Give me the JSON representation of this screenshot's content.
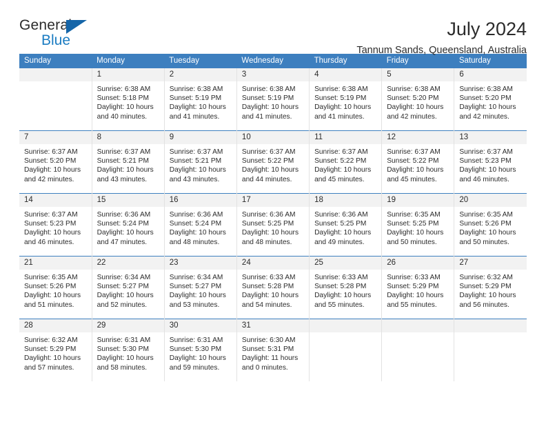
{
  "brand": {
    "name_part1": "General",
    "name_part2": "Blue",
    "logo_icon": "triangle-flag-icon"
  },
  "header": {
    "title": "July 2024",
    "subtitle": "Tannum Sands, Queensland, Australia"
  },
  "colors": {
    "header_blue": "#3d7fbf",
    "brand_blue": "#1b7cc2",
    "logo_blue": "#1565a8",
    "daynum_band": "#f2f2f2",
    "cell_divider": "#e2e2e2",
    "text": "#2b2b2b"
  },
  "weekday_headers": [
    "Sunday",
    "Monday",
    "Tuesday",
    "Wednesday",
    "Thursday",
    "Friday",
    "Saturday"
  ],
  "weeks": [
    [
      {
        "day": "",
        "sunrise": "",
        "sunset": "",
        "daylight_line1": "",
        "daylight_line2": ""
      },
      {
        "day": "1",
        "sunrise": "Sunrise: 6:38 AM",
        "sunset": "Sunset: 5:18 PM",
        "daylight_line1": "Daylight: 10 hours",
        "daylight_line2": "and 40 minutes."
      },
      {
        "day": "2",
        "sunrise": "Sunrise: 6:38 AM",
        "sunset": "Sunset: 5:19 PM",
        "daylight_line1": "Daylight: 10 hours",
        "daylight_line2": "and 41 minutes."
      },
      {
        "day": "3",
        "sunrise": "Sunrise: 6:38 AM",
        "sunset": "Sunset: 5:19 PM",
        "daylight_line1": "Daylight: 10 hours",
        "daylight_line2": "and 41 minutes."
      },
      {
        "day": "4",
        "sunrise": "Sunrise: 6:38 AM",
        "sunset": "Sunset: 5:19 PM",
        "daylight_line1": "Daylight: 10 hours",
        "daylight_line2": "and 41 minutes."
      },
      {
        "day": "5",
        "sunrise": "Sunrise: 6:38 AM",
        "sunset": "Sunset: 5:20 PM",
        "daylight_line1": "Daylight: 10 hours",
        "daylight_line2": "and 42 minutes."
      },
      {
        "day": "6",
        "sunrise": "Sunrise: 6:38 AM",
        "sunset": "Sunset: 5:20 PM",
        "daylight_line1": "Daylight: 10 hours",
        "daylight_line2": "and 42 minutes."
      }
    ],
    [
      {
        "day": "7",
        "sunrise": "Sunrise: 6:37 AM",
        "sunset": "Sunset: 5:20 PM",
        "daylight_line1": "Daylight: 10 hours",
        "daylight_line2": "and 42 minutes."
      },
      {
        "day": "8",
        "sunrise": "Sunrise: 6:37 AM",
        "sunset": "Sunset: 5:21 PM",
        "daylight_line1": "Daylight: 10 hours",
        "daylight_line2": "and 43 minutes."
      },
      {
        "day": "9",
        "sunrise": "Sunrise: 6:37 AM",
        "sunset": "Sunset: 5:21 PM",
        "daylight_line1": "Daylight: 10 hours",
        "daylight_line2": "and 43 minutes."
      },
      {
        "day": "10",
        "sunrise": "Sunrise: 6:37 AM",
        "sunset": "Sunset: 5:22 PM",
        "daylight_line1": "Daylight: 10 hours",
        "daylight_line2": "and 44 minutes."
      },
      {
        "day": "11",
        "sunrise": "Sunrise: 6:37 AM",
        "sunset": "Sunset: 5:22 PM",
        "daylight_line1": "Daylight: 10 hours",
        "daylight_line2": "and 45 minutes."
      },
      {
        "day": "12",
        "sunrise": "Sunrise: 6:37 AM",
        "sunset": "Sunset: 5:22 PM",
        "daylight_line1": "Daylight: 10 hours",
        "daylight_line2": "and 45 minutes."
      },
      {
        "day": "13",
        "sunrise": "Sunrise: 6:37 AM",
        "sunset": "Sunset: 5:23 PM",
        "daylight_line1": "Daylight: 10 hours",
        "daylight_line2": "and 46 minutes."
      }
    ],
    [
      {
        "day": "14",
        "sunrise": "Sunrise: 6:37 AM",
        "sunset": "Sunset: 5:23 PM",
        "daylight_line1": "Daylight: 10 hours",
        "daylight_line2": "and 46 minutes."
      },
      {
        "day": "15",
        "sunrise": "Sunrise: 6:36 AM",
        "sunset": "Sunset: 5:24 PM",
        "daylight_line1": "Daylight: 10 hours",
        "daylight_line2": "and 47 minutes."
      },
      {
        "day": "16",
        "sunrise": "Sunrise: 6:36 AM",
        "sunset": "Sunset: 5:24 PM",
        "daylight_line1": "Daylight: 10 hours",
        "daylight_line2": "and 48 minutes."
      },
      {
        "day": "17",
        "sunrise": "Sunrise: 6:36 AM",
        "sunset": "Sunset: 5:25 PM",
        "daylight_line1": "Daylight: 10 hours",
        "daylight_line2": "and 48 minutes."
      },
      {
        "day": "18",
        "sunrise": "Sunrise: 6:36 AM",
        "sunset": "Sunset: 5:25 PM",
        "daylight_line1": "Daylight: 10 hours",
        "daylight_line2": "and 49 minutes."
      },
      {
        "day": "19",
        "sunrise": "Sunrise: 6:35 AM",
        "sunset": "Sunset: 5:25 PM",
        "daylight_line1": "Daylight: 10 hours",
        "daylight_line2": "and 50 minutes."
      },
      {
        "day": "20",
        "sunrise": "Sunrise: 6:35 AM",
        "sunset": "Sunset: 5:26 PM",
        "daylight_line1": "Daylight: 10 hours",
        "daylight_line2": "and 50 minutes."
      }
    ],
    [
      {
        "day": "21",
        "sunrise": "Sunrise: 6:35 AM",
        "sunset": "Sunset: 5:26 PM",
        "daylight_line1": "Daylight: 10 hours",
        "daylight_line2": "and 51 minutes."
      },
      {
        "day": "22",
        "sunrise": "Sunrise: 6:34 AM",
        "sunset": "Sunset: 5:27 PM",
        "daylight_line1": "Daylight: 10 hours",
        "daylight_line2": "and 52 minutes."
      },
      {
        "day": "23",
        "sunrise": "Sunrise: 6:34 AM",
        "sunset": "Sunset: 5:27 PM",
        "daylight_line1": "Daylight: 10 hours",
        "daylight_line2": "and 53 minutes."
      },
      {
        "day": "24",
        "sunrise": "Sunrise: 6:33 AM",
        "sunset": "Sunset: 5:28 PM",
        "daylight_line1": "Daylight: 10 hours",
        "daylight_line2": "and 54 minutes."
      },
      {
        "day": "25",
        "sunrise": "Sunrise: 6:33 AM",
        "sunset": "Sunset: 5:28 PM",
        "daylight_line1": "Daylight: 10 hours",
        "daylight_line2": "and 55 minutes."
      },
      {
        "day": "26",
        "sunrise": "Sunrise: 6:33 AM",
        "sunset": "Sunset: 5:29 PM",
        "daylight_line1": "Daylight: 10 hours",
        "daylight_line2": "and 55 minutes."
      },
      {
        "day": "27",
        "sunrise": "Sunrise: 6:32 AM",
        "sunset": "Sunset: 5:29 PM",
        "daylight_line1": "Daylight: 10 hours",
        "daylight_line2": "and 56 minutes."
      }
    ],
    [
      {
        "day": "28",
        "sunrise": "Sunrise: 6:32 AM",
        "sunset": "Sunset: 5:29 PM",
        "daylight_line1": "Daylight: 10 hours",
        "daylight_line2": "and 57 minutes."
      },
      {
        "day": "29",
        "sunrise": "Sunrise: 6:31 AM",
        "sunset": "Sunset: 5:30 PM",
        "daylight_line1": "Daylight: 10 hours",
        "daylight_line2": "and 58 minutes."
      },
      {
        "day": "30",
        "sunrise": "Sunrise: 6:31 AM",
        "sunset": "Sunset: 5:30 PM",
        "daylight_line1": "Daylight: 10 hours",
        "daylight_line2": "and 59 minutes."
      },
      {
        "day": "31",
        "sunrise": "Sunrise: 6:30 AM",
        "sunset": "Sunset: 5:31 PM",
        "daylight_line1": "Daylight: 11 hours",
        "daylight_line2": "and 0 minutes."
      },
      {
        "day": "",
        "sunrise": "",
        "sunset": "",
        "daylight_line1": "",
        "daylight_line2": ""
      },
      {
        "day": "",
        "sunrise": "",
        "sunset": "",
        "daylight_line1": "",
        "daylight_line2": ""
      },
      {
        "day": "",
        "sunrise": "",
        "sunset": "",
        "daylight_line1": "",
        "daylight_line2": ""
      }
    ]
  ]
}
